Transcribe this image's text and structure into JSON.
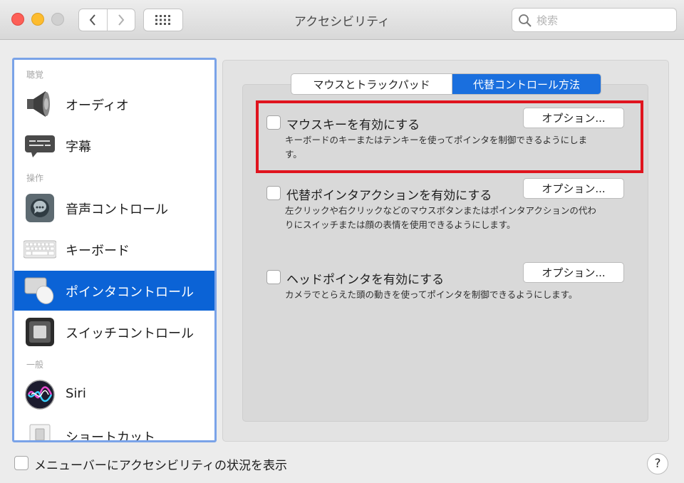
{
  "window": {
    "title": "アクセシビリティ",
    "search_placeholder": "検索",
    "accent_color": "#1a6fde",
    "highlight_color": "#e0141e"
  },
  "sidebar": {
    "sections": [
      {
        "header": "聴覚",
        "items": [
          {
            "label": "オーディオ",
            "icon": "speaker-icon",
            "selected": false
          },
          {
            "label": "字幕",
            "icon": "captions-icon",
            "selected": false
          }
        ]
      },
      {
        "header": "操作",
        "items": [
          {
            "label": "音声コントロール",
            "icon": "voice-control-icon",
            "selected": false
          },
          {
            "label": "キーボード",
            "icon": "keyboard-icon",
            "selected": false
          },
          {
            "label": "ポインタコントロール",
            "icon": "pointer-control-icon",
            "selected": true
          },
          {
            "label": "スイッチコントロール",
            "icon": "switch-control-icon",
            "selected": false
          }
        ]
      },
      {
        "header": "一般",
        "items": [
          {
            "label": "Siri",
            "icon": "siri-icon",
            "selected": false
          },
          {
            "label": "ショートカット",
            "icon": "shortcut-icon",
            "selected": false
          }
        ]
      }
    ]
  },
  "tabs": [
    {
      "label": "マウスとトラックパッド",
      "selected": false
    },
    {
      "label": "代替コントロール方法",
      "selected": true
    }
  ],
  "options": [
    {
      "label": "マウスキーを有効にする",
      "checked": false,
      "button": "オプション...",
      "description": "キーボードのキーまたはテンキーを使ってポインタを制御できるようにします。",
      "highlighted": true
    },
    {
      "label": "代替ポインタアクションを有効にする",
      "checked": false,
      "button": "オプション...",
      "description": "左クリックや右クリックなどのマウスボタンまたはポインタアクションの代わりにスイッチまたは顔の表情を使用できるようにします。",
      "highlighted": false
    },
    {
      "label": "ヘッドポインタを有効にする",
      "checked": false,
      "button": "オプション...",
      "description": "カメラでとらえた頭の動きを使ってポインタを制御できるようにします。",
      "highlighted": false
    }
  ],
  "bottom": {
    "show_status_label": "メニューバーにアクセシビリティの状況を表示",
    "show_status_checked": false,
    "help_label": "?"
  }
}
